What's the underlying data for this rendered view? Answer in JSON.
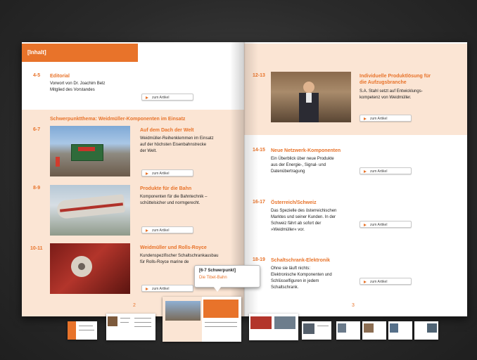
{
  "left_page": {
    "header": "[Inhalt]",
    "editorial": {
      "num": "4-5",
      "title": "Editorial",
      "text": [
        "Vorwort von Dr. Joachim Belz",
        "Mitglied des Vorstandes"
      ],
      "button": "zum Artikel"
    },
    "section_title": "Schwerpunktthema: Weidmüller-Komponenten im Einsatz",
    "articles": [
      {
        "num": "6-7",
        "title": "Auf dem Dach der Welt",
        "text": [
          "Weidmüller-Reihenklemmen im Einsatz",
          "auf der höchsten Eisenbahnstrecke",
          "der Welt."
        ],
        "button": "zum Artikel"
      },
      {
        "num": "8-9",
        "title": "Produkte für die Bahn",
        "text": [
          "Komponenten für die Bahntechnik –",
          "schüttelsicher und normgerecht."
        ],
        "button": "zum Artikel"
      },
      {
        "num": "10-11",
        "title": "Weidmüller und Rolls-Royce",
        "text": [
          "Kundenspezifischer Schaltschrankausbau",
          "für Rolls-Royce marine de"
        ],
        "button": "zum Artikel"
      }
    ],
    "page_number": "2"
  },
  "right_page": {
    "articles": [
      {
        "num": "12-13",
        "title": [
          "Individuelle Produktlösung für",
          "die Aufzugsbranche"
        ],
        "text": [
          "S.A. Stahl setzt auf Entwicklungs-",
          "kompetenz von Weidmüller."
        ],
        "button": "zum Artikel"
      },
      {
        "num": "14-15",
        "title": [
          "Neue Netzwerk-Komponenten"
        ],
        "text": [
          "Ein Überblick über neue Produkte",
          "aus der Energie-, Signal- und",
          "Datenübertragung"
        ],
        "button": "zum Artikel"
      },
      {
        "num": "16-17",
        "title": [
          "Österreich/Schweiz"
        ],
        "text": [
          "Das Spezielle des österreichischen",
          "Marktes und seiner Kunden. In der",
          "Schweiz fährt ab sofort der",
          "»Weidmüller« vor."
        ],
        "button": "zum Artikel"
      },
      {
        "num": "18-19",
        "title": [
          "Schaltschrank-Elektronik"
        ],
        "text": [
          "Ohne sie läuft nichts:",
          "Elektronische Komponenten und",
          "Schlüsselfiguren in jedem",
          "Schaltschrank."
        ],
        "button": "zum Artikel"
      }
    ],
    "page_number": "3"
  },
  "tooltip": {
    "line1": "[6-7 Schwerpunkt]",
    "line2": "Die Tibet-Bahn"
  },
  "colors": {
    "accent": "#e8732a",
    "peach": "#fbe5d4",
    "background": "#2a2a2a"
  }
}
